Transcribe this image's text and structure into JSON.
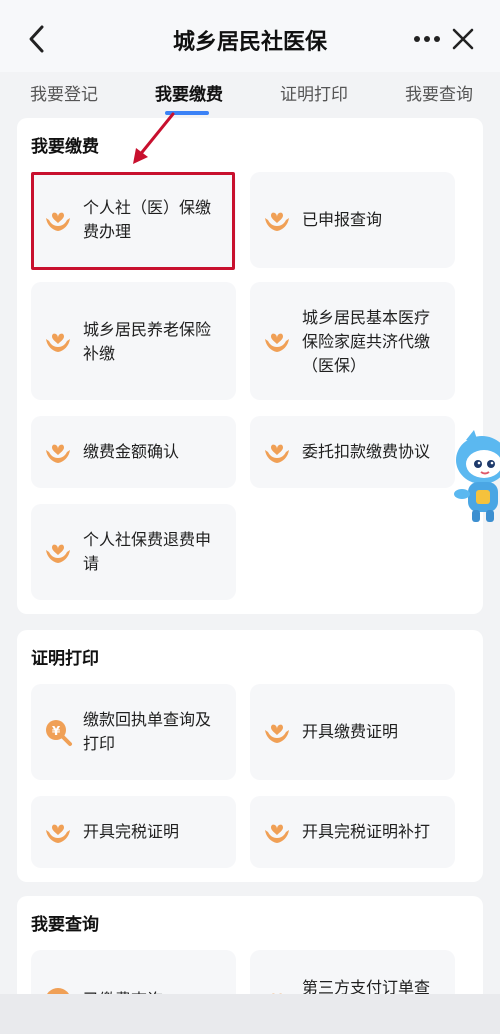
{
  "header": {
    "title": "城乡居民社医保"
  },
  "tabs": [
    {
      "label": "我要登记"
    },
    {
      "label": "我要缴费"
    },
    {
      "label": "证明打印"
    },
    {
      "label": "我要查询"
    }
  ],
  "sections": {
    "payment": {
      "title": "我要缴费",
      "items": [
        {
          "label": "个人社（医）保缴费办理",
          "icon": "heart-hands-icon"
        },
        {
          "label": "已申报查询",
          "icon": "heart-hands-icon"
        },
        {
          "label": "城乡居民养老保险补缴",
          "icon": "heart-hands-icon"
        },
        {
          "label": "城乡居民基本医疗保险家庭共济代缴（医保）",
          "icon": "heart-hands-icon"
        },
        {
          "label": "缴费金额确认",
          "icon": "heart-hands-icon"
        },
        {
          "label": "委托扣款缴费协议",
          "icon": "heart-hands-icon"
        },
        {
          "label": "个人社保费退费申请",
          "icon": "heart-hands-icon"
        }
      ]
    },
    "certificate": {
      "title": "证明打印",
      "items": [
        {
          "label": "缴款回执单查询及打印",
          "icon": "search-money-icon"
        },
        {
          "label": "开具缴费证明",
          "icon": "heart-hands-icon"
        },
        {
          "label": "开具完税证明",
          "icon": "heart-hands-icon"
        },
        {
          "label": "开具完税证明补打",
          "icon": "heart-hands-icon"
        }
      ]
    },
    "query": {
      "title": "我要查询",
      "items": [
        {
          "label": "已缴费查询",
          "icon": "yuan-icon"
        },
        {
          "label": "第三方支付订单查询",
          "icon": "heart-hands-icon"
        }
      ]
    }
  },
  "colors": {
    "accent": "#3b82f6",
    "icon_orange": "#f0a056",
    "highlight": "#c8102e"
  }
}
